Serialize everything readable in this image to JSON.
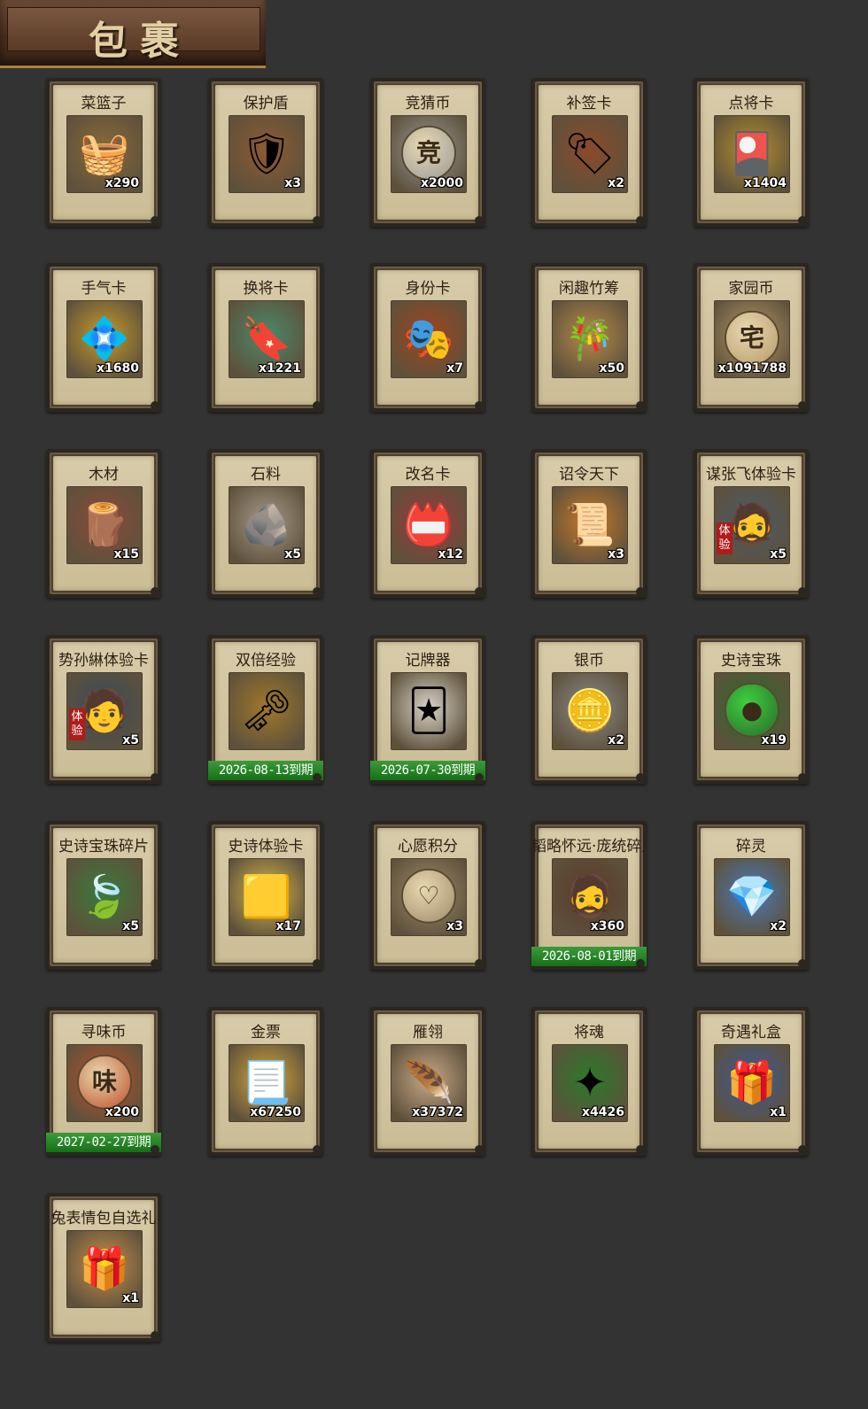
{
  "header": {
    "title": "包裹"
  },
  "items": [
    {
      "name": "菜篮子",
      "count": "x290",
      "icon": "🧺",
      "bg": "#8a6a3a"
    },
    {
      "name": "保护盾",
      "count": "x3",
      "icon": "🛡",
      "bg": "#8e5a32"
    },
    {
      "name": "竞猜币",
      "count": "x2000",
      "icon": "竞",
      "bg": "#9a9a9a",
      "round": true
    },
    {
      "name": "补签卡",
      "count": "x2",
      "icon": "🏷",
      "bg": "#8a4a2a"
    },
    {
      "name": "点将卡",
      "count": "x1404",
      "icon": "🎴",
      "bg": "#b8902a"
    },
    {
      "name": "手气卡",
      "count": "x1680",
      "icon": "💠",
      "bg": "#c89a2a"
    },
    {
      "name": "换将卡",
      "count": "x1221",
      "icon": "🔖",
      "bg": "#4a8a6a"
    },
    {
      "name": "身份卡",
      "count": "x7",
      "icon": "🎭",
      "bg": "#a0441e"
    },
    {
      "name": "闲趣竹筹",
      "count": "x50",
      "icon": "🎋",
      "bg": "#b88a4a"
    },
    {
      "name": "家园币",
      "count": "x1091788",
      "icon": "宅",
      "bg": "#b89a6a",
      "round": true
    },
    {
      "name": "木材",
      "count": "x15",
      "icon": "🪵",
      "bg": "#8a4a3a"
    },
    {
      "name": "石料",
      "count": "x5",
      "icon": "🪨",
      "bg": "#a89a8a"
    },
    {
      "name": "改名卡",
      "count": "x12",
      "icon": "📛",
      "bg": "#9a3a3a"
    },
    {
      "name": "诏令天下",
      "count": "x3",
      "icon": "📜",
      "bg": "#c87a2a"
    },
    {
      "name": "谋张飞体验卡",
      "count": "x5",
      "icon": "🧔",
      "bg": "#4a5a6a",
      "hero": true
    },
    {
      "name": "势孙綝体验卡",
      "count": "x5",
      "icon": "🧑",
      "bg": "#3a4a5a",
      "hero": true
    },
    {
      "name": "双倍经验",
      "count": "",
      "icon": "🗝",
      "bg": "#a0782a",
      "expiry": "2026-08-13到期"
    },
    {
      "name": "记牌器",
      "count": "",
      "icon": "🃏",
      "bg": "#d8d2c4",
      "expiry": "2026-07-30到期"
    },
    {
      "name": "银币",
      "count": "x2",
      "icon": "🪙",
      "bg": "#8a8a8a"
    },
    {
      "name": "史诗宝珠",
      "count": "x19",
      "icon": "●",
      "bg": "#2a6a2a",
      "round": true,
      "roundColor": "#3ecf3e"
    },
    {
      "name": "史诗宝珠碎片",
      "count": "x5",
      "icon": "🍃",
      "bg": "#3a7a3a"
    },
    {
      "name": "史诗体验卡",
      "count": "x17",
      "icon": "🟨",
      "bg": "#d8b84a"
    },
    {
      "name": "心愿积分",
      "count": "x3",
      "icon": "♡",
      "bg": "#a08a6a",
      "round": true
    },
    {
      "name": "韬略怀远·庞统碎片",
      "count": "x360",
      "icon": "🧔",
      "bg": "#5a3a2a",
      "expiry": "2026-08-01到期"
    },
    {
      "name": "碎灵",
      "count": "x2",
      "icon": "💎",
      "bg": "#4a7ab8"
    },
    {
      "name": "寻味币",
      "count": "x200",
      "icon": "味",
      "bg": "#c0502a",
      "round": true,
      "expiry": "2027-02-27到期"
    },
    {
      "name": "金票",
      "count": "x67250",
      "icon": "📃",
      "bg": "#d8a83a"
    },
    {
      "name": "雁翎",
      "count": "x37372",
      "icon": "🪶",
      "bg": "#c8a888"
    },
    {
      "name": "将魂",
      "count": "x4426",
      "icon": "✦",
      "bg": "#2a7a2a"
    },
    {
      "name": "奇遇礼盒",
      "count": "x1",
      "icon": "🎁",
      "bg": "#3a5a9a"
    },
    {
      "name": "兔表情包自选礼",
      "count": "x1",
      "icon": "🎁",
      "bg": "#c8904a"
    }
  ]
}
